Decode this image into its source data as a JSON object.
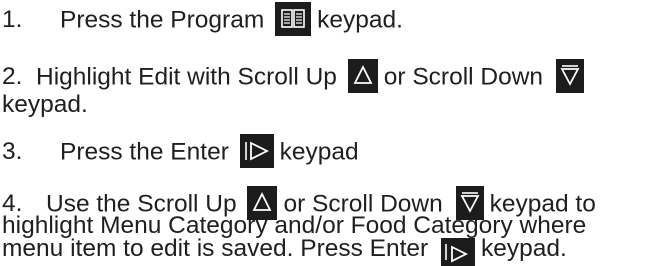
{
  "steps": [
    {
      "num": "1.",
      "text_a": "Press the Program",
      "text_b": "keypad."
    },
    {
      "num": "2.",
      "text_a": "Highlight Edit with Scroll Up",
      "text_b": "or Scroll Down",
      "text_c": "keypad."
    },
    {
      "num": "3.",
      "text_a": "Press the Enter",
      "text_b": "keypad"
    },
    {
      "num": "4.",
      "text_a": "Use the Scroll Up",
      "text_b": "or Scroll Down",
      "text_c": "keypad to",
      "line2": "highlight Menu Category and/or Food Category where",
      "line3_a": "menu item to edit is saved. Press Enter",
      "line3_b": "keypad."
    }
  ],
  "icons": {
    "program": "book-icon",
    "scroll_up": "triangle-up-icon",
    "scroll_down": "triangle-down-icon",
    "enter": "triangle-right-icon"
  },
  "colors": {
    "text": "#1f1f1f",
    "keypad_bg": "#1c1c1c",
    "keypad_glyph": "#ffffff"
  }
}
